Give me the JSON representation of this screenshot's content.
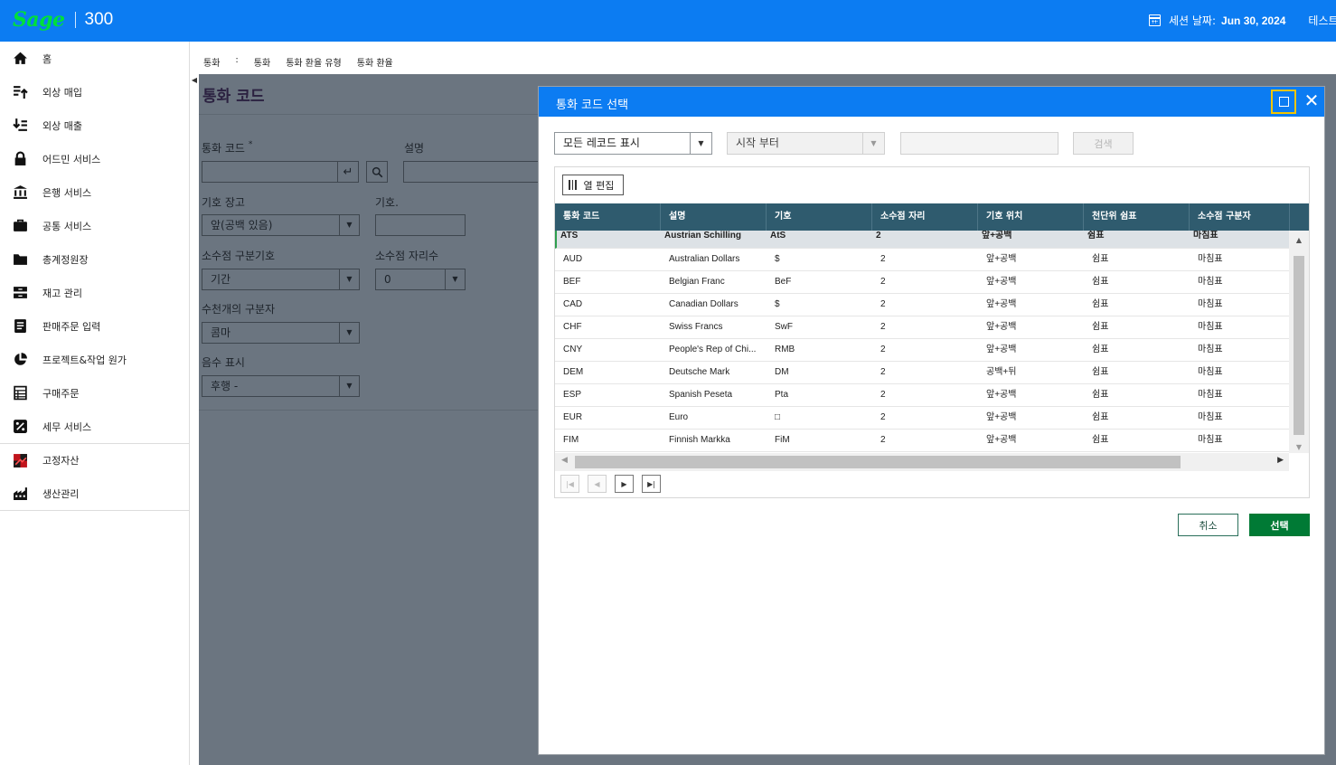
{
  "header": {
    "brand": "Sage",
    "product": "300",
    "session_label": "세션 날짜:",
    "session_date": "Jun 30, 2024",
    "user": "테스트"
  },
  "sidebar": {
    "items": [
      {
        "label": "홈",
        "icon": "home-icon"
      },
      {
        "label": "외상 매입",
        "icon": "payables-icon"
      },
      {
        "label": "외상 매출",
        "icon": "receivables-icon"
      },
      {
        "label": "어드민 서비스",
        "icon": "lock-icon"
      },
      {
        "label": "은행 서비스",
        "icon": "bank-icon"
      },
      {
        "label": "공통 서비스",
        "icon": "briefcase-icon"
      },
      {
        "label": "총계정원장",
        "icon": "folder-icon"
      },
      {
        "label": "재고 관리",
        "icon": "inventory-icon"
      },
      {
        "label": "판매주문 입력",
        "icon": "order-entry-icon"
      },
      {
        "label": "프로젝트&작업 원가",
        "icon": "pie-chart-icon"
      },
      {
        "label": "구매주문",
        "icon": "purchase-order-icon"
      },
      {
        "label": "세무 서비스",
        "icon": "tax-percent-icon"
      },
      {
        "label": "고정자산",
        "icon": "fixed-assets-icon"
      },
      {
        "label": "생산관리",
        "icon": "factory-icon"
      }
    ]
  },
  "breadcrumb": [
    "통화",
    ":",
    "통화",
    "통화 환율 유형",
    "통화 환율"
  ],
  "form": {
    "title": "통화 코드",
    "currency_code_label": "통화 코드",
    "required_mark": "*",
    "description_label": "설명",
    "symbol_position_label": "기호 장고",
    "symbol_position_value": "앞(공백 있음)",
    "symbol_label": "기호.",
    "decimal_sep_label": "소수점 구분기호",
    "decimal_sep_value": "기간",
    "decimal_places_label": "소수점 자리수",
    "decimal_places_value": "0",
    "thousands_sep_label": "수천개의 구분자",
    "thousands_sep_value": "콤마",
    "negative_label": "음수 표시",
    "negative_value": "후행 -"
  },
  "dialog": {
    "title": "통화 코드 선택",
    "filter_value": "모든 레코드 표시",
    "start_from_value": "시작 부터",
    "search_value": "",
    "search_label": "검색",
    "edit_columns_label": "열 편집",
    "columns": [
      "통화 코드",
      "설명",
      "기호",
      "소수점 자리",
      "기호 위치",
      "천단위 쉼표",
      "소수점 구분자"
    ],
    "rows": [
      [
        "ATS",
        "Austrian Schilling",
        "AtS",
        "2",
        "앞+공백",
        "쉼표",
        "마침표"
      ],
      [
        "AUD",
        "Australian Dollars",
        "$",
        "2",
        "앞+공백",
        "쉼표",
        "마침표"
      ],
      [
        "BEF",
        "Belgian Franc",
        "BeF",
        "2",
        "앞+공백",
        "쉼표",
        "마침표"
      ],
      [
        "CAD",
        "Canadian Dollars",
        "$",
        "2",
        "앞+공백",
        "쉼표",
        "마침표"
      ],
      [
        "CHF",
        "Swiss Francs",
        "SwF",
        "2",
        "앞+공백",
        "쉼표",
        "마침표"
      ],
      [
        "CNY",
        "People's Rep of Chi...",
        "RMB",
        "2",
        "앞+공백",
        "쉼표",
        "마침표"
      ],
      [
        "DEM",
        "Deutsche Mark",
        "DM",
        "2",
        "공백+뒤",
        "쉼표",
        "마침표"
      ],
      [
        "ESP",
        "Spanish Peseta",
        "Pta",
        "2",
        "앞+공백",
        "쉼표",
        "마침표"
      ],
      [
        "EUR",
        "Euro",
        "□",
        "2",
        "앞+공백",
        "쉼표",
        "마침표"
      ],
      [
        "FIM",
        "Finnish Markka",
        "FiM",
        "2",
        "앞+공백",
        "쉼표",
        "마침표"
      ]
    ],
    "cancel_label": "취소",
    "select_label": "선택"
  }
}
